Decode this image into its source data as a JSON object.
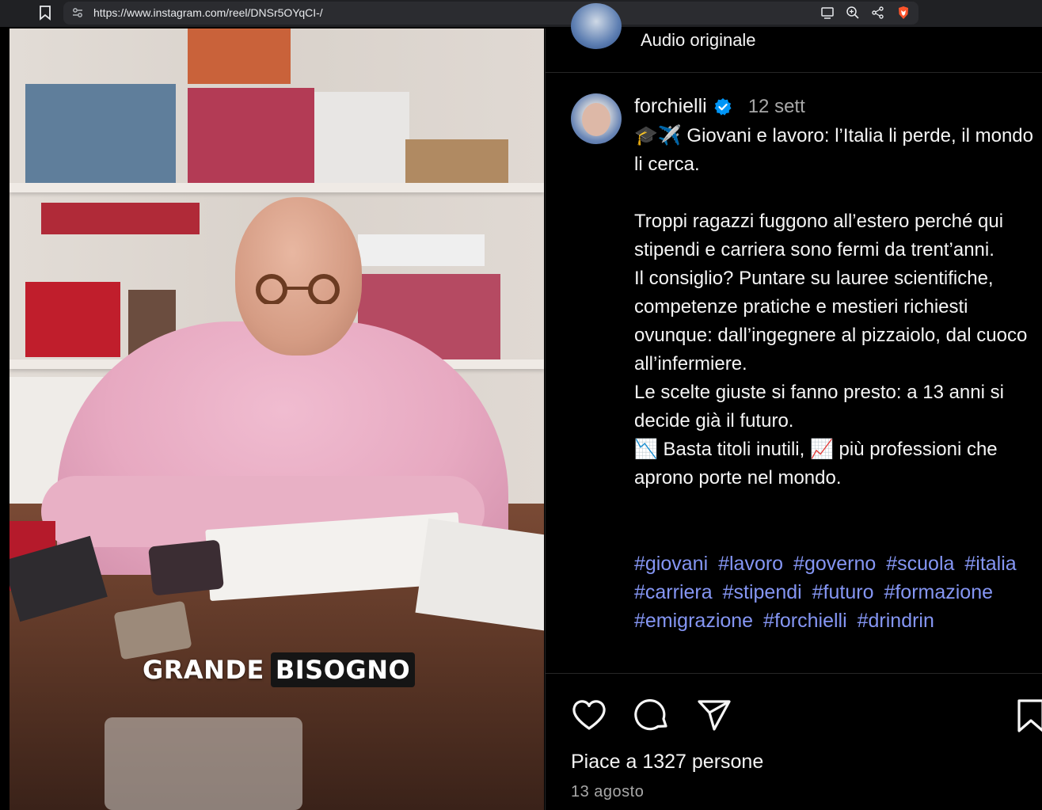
{
  "browser": {
    "url": "https://www.instagram.com/reel/DNSr5OYqCI-/",
    "icons": [
      "bookmark-icon",
      "site-settings-icon",
      "cast-icon",
      "zoom-icon",
      "share-icon",
      "brave-shield-icon"
    ]
  },
  "video": {
    "caption_word_1": "GRANDE",
    "caption_word_2": "BISOGNO"
  },
  "audio": {
    "label": "Audio originale"
  },
  "post": {
    "username": "forchielli",
    "verified": true,
    "date": "12 sett",
    "caption_lines": [
      "🎓✈️ Giovani e lavoro: l’Italia li perde, il mondo li cerca.",
      "",
      "Troppi ragazzi fuggono all’estero perché qui stipendi e carriera sono fermi da trent’anni.",
      "Il consiglio? Puntare su lauree scientifiche, competenze pratiche e mestieri richiesti ovunque: dall’ingegnere al pizzaiolo, dal cuoco all’infermiere.",
      "Le scelte giuste si fanno presto: a 13 anni si decide già il futuro.",
      "📉 Basta titoli inutili, 📈 più professioni che aprono porte nel mondo."
    ],
    "hashtags": [
      "#giovani",
      "#lavoro",
      "#governo",
      "#scuola",
      "#italia",
      "#carriera",
      "#stipendi",
      "#futuro",
      "#formazione",
      "#emigrazione",
      "#forchielli",
      "#drindrin"
    ],
    "likes_text": "Piace a 1327 persone",
    "timestamp": "13 agosto"
  },
  "colors": {
    "background": "#000000",
    "hashtag": "#8596f4",
    "muted": "#a8a8a8",
    "verified": "#0095f6"
  }
}
